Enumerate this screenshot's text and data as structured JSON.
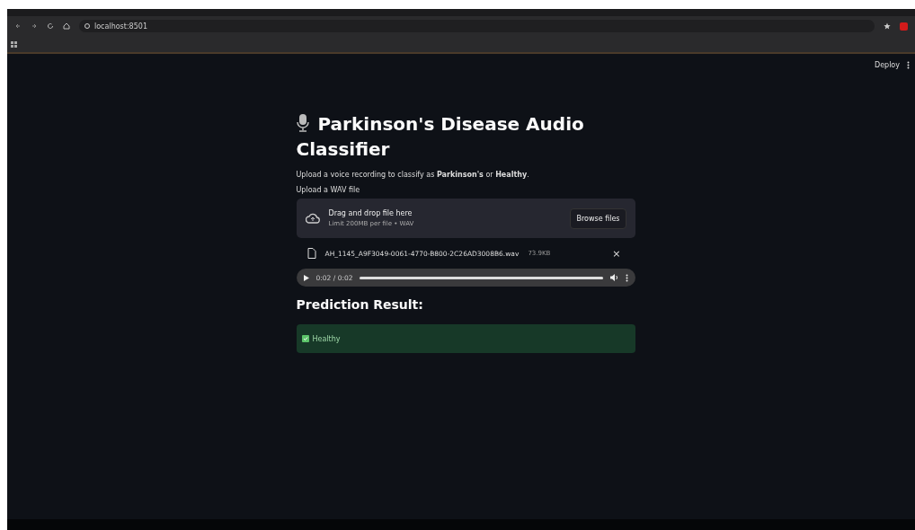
{
  "browser": {
    "url": "localhost:8501"
  },
  "header": {
    "deploy": "Deploy"
  },
  "title": "Parkinson's Disease Audio Classifier",
  "intro": "Upload a voice recording to classify as **Parkinson's** or **Healthy**.",
  "uploader": {
    "label": "Upload a WAV file",
    "drop_text": "Drag and drop file here",
    "limit": "Limit 200MB per file • WAV",
    "button": "Browse files"
  },
  "file": {
    "name": "AH_1145_A9F3049-0061-4770-B800-2C26AD3008B6.wav",
    "size": "73.9KB",
    "remove": "×"
  },
  "player": {
    "time": "0:02 / 0:02",
    "level": 1.0
  },
  "result": {
    "heading": "Prediction Result:",
    "label": "Healthy"
  }
}
